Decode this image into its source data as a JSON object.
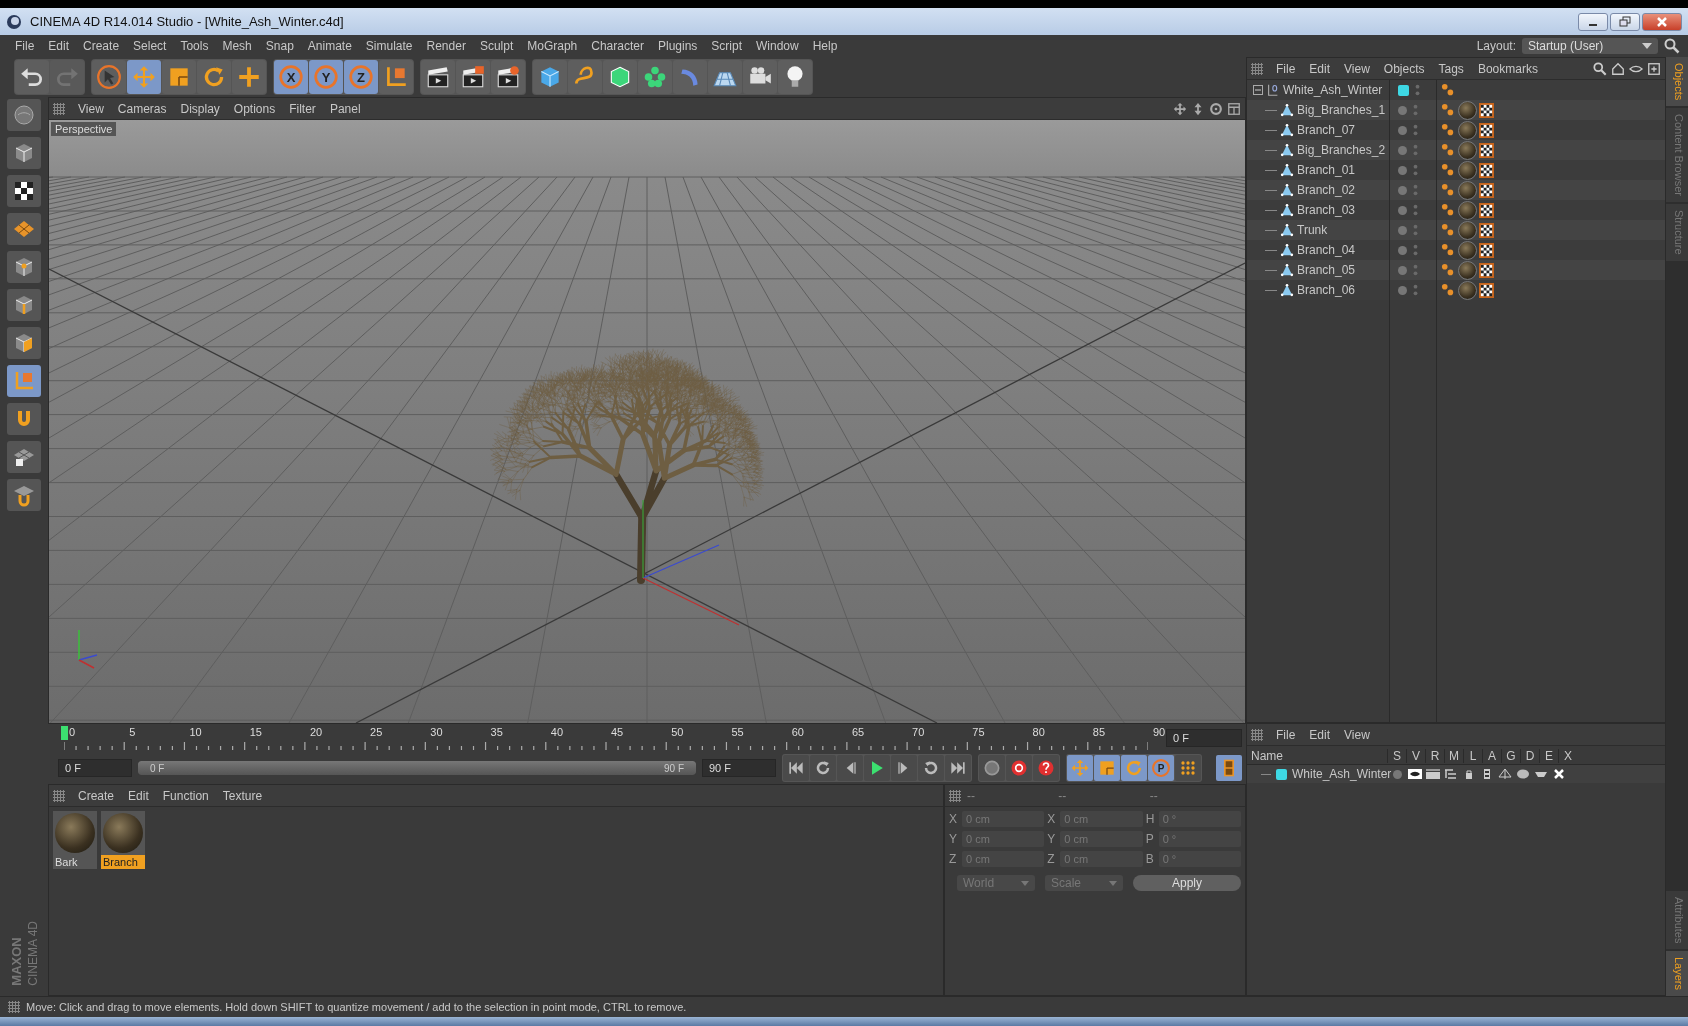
{
  "window": {
    "title": "CINEMA 4D R14.014 Studio - [White_Ash_Winter.c4d]"
  },
  "menu_bar": [
    "File",
    "Edit",
    "Create",
    "Select",
    "Tools",
    "Mesh",
    "Snap",
    "Animate",
    "Simulate",
    "Render",
    "Sculpt",
    "MoGraph",
    "Character",
    "Plugins",
    "Script",
    "Window",
    "Help"
  ],
  "layout": {
    "label": "Layout:",
    "value": "Startup (User)"
  },
  "toolbar": [
    {
      "items": [
        {
          "kind": "undo",
          "disabled": false,
          "selected": false
        },
        {
          "kind": "redo",
          "disabled": true,
          "selected": false
        }
      ]
    },
    {
      "items": [
        {
          "kind": "select",
          "selected": false
        },
        {
          "kind": "move",
          "selected": true
        },
        {
          "kind": "scale",
          "selected": false
        },
        {
          "kind": "rotate",
          "selected": false
        },
        {
          "kind": "add",
          "selected": false
        }
      ]
    },
    {
      "items": [
        {
          "kind": "axis-lock",
          "label": "X",
          "selected": true
        },
        {
          "kind": "axis-lock",
          "label": "Y",
          "selected": true
        },
        {
          "kind": "axis-lock",
          "label": "Z",
          "selected": true
        },
        {
          "kind": "coordinate-system",
          "selected": false
        }
      ]
    },
    {
      "items": [
        {
          "kind": "render-view",
          "selected": false
        },
        {
          "kind": "render-picture",
          "selected": false
        },
        {
          "kind": "render-settings",
          "selected": false
        }
      ]
    },
    {
      "items": [
        {
          "kind": "cube",
          "selected": false
        },
        {
          "kind": "spline",
          "selected": false
        },
        {
          "kind": "subdivision",
          "selected": false
        },
        {
          "kind": "cloner",
          "selected": false
        },
        {
          "kind": "deformer",
          "selected": false
        },
        {
          "kind": "floor",
          "selected": false
        },
        {
          "kind": "camera",
          "selected": false
        },
        {
          "kind": "light",
          "selected": false
        }
      ]
    }
  ],
  "left_toolbar": [
    {
      "kind": "sculpt",
      "selected": false
    },
    {
      "kind": "model",
      "selected": false
    },
    {
      "kind": "texture",
      "selected": false
    },
    {
      "kind": "workplane",
      "selected": false
    },
    {
      "kind": "points",
      "selected": false
    },
    {
      "kind": "edges",
      "selected": false
    },
    {
      "kind": "polygons",
      "selected": false
    },
    {
      "kind": "axis-mode",
      "selected": true
    },
    {
      "kind": "magnet",
      "selected": false
    },
    {
      "kind": "grid-lock",
      "selected": false
    },
    {
      "kind": "snap",
      "selected": false
    }
  ],
  "viewport": {
    "menu": [
      "View",
      "Cameras",
      "Display",
      "Options",
      "Filter",
      "Panel"
    ],
    "camera_label": "Perspective"
  },
  "timeline": {
    "ruler_labels": [
      "0",
      "5",
      "10",
      "15",
      "20",
      "25",
      "30",
      "35",
      "40",
      "45",
      "50",
      "55",
      "60",
      "65",
      "70",
      "75",
      "80",
      "85",
      "90"
    ],
    "current_frame": "0 F",
    "start": "0 F",
    "range": {
      "start": "0 F",
      "end": "90 F",
      "level": 1
    },
    "end": "90 F",
    "transport": [
      {
        "kind": "go-start"
      },
      {
        "kind": "prev-key"
      },
      {
        "kind": "prev-frame"
      },
      {
        "kind": "play"
      },
      {
        "kind": "next-frame"
      },
      {
        "kind": "next-key"
      },
      {
        "kind": "go-end"
      }
    ],
    "record": [
      {
        "kind": "keyframe-off"
      },
      {
        "kind": "record"
      },
      {
        "kind": "autokey"
      }
    ],
    "key_modes": [
      {
        "kind": "key-move",
        "selected": true
      },
      {
        "kind": "key-scale",
        "selected": true
      },
      {
        "kind": "key-rotate",
        "selected": true
      },
      {
        "kind": "key-param",
        "label": "P",
        "selected": true
      },
      {
        "kind": "key-points",
        "selected": false
      }
    ]
  },
  "materials": {
    "menu": [
      "Create",
      "Edit",
      "Function",
      "Texture"
    ],
    "items": [
      {
        "name": "Bark",
        "selected": false
      },
      {
        "name": "Branch",
        "selected": true
      }
    ]
  },
  "coordinates": {
    "headers": [
      "--",
      "--",
      "--"
    ],
    "rows": [
      {
        "pos_label": "X",
        "pos": "0 cm",
        "size_label": "X",
        "size": "0 cm",
        "rot_label": "H",
        "rot": "0 °"
      },
      {
        "pos_label": "Y",
        "pos": "0 cm",
        "size_label": "Y",
        "size": "0 cm",
        "rot_label": "P",
        "rot": "0 °"
      },
      {
        "pos_label": "Z",
        "pos": "0 cm",
        "size_label": "Z",
        "size": "0 cm",
        "rot_label": "B",
        "rot": "0 °"
      }
    ],
    "dropdowns": [
      "World",
      "Scale"
    ],
    "apply": "Apply"
  },
  "object_manager": {
    "menu": [
      "File",
      "Edit",
      "View",
      "Objects",
      "Tags",
      "Bookmarks"
    ],
    "objects": [
      {
        "name": "White_Ash_Winter",
        "kind": "null",
        "color": "#3ed8e4",
        "expanded": true,
        "tags": [
          {
            "kind": "phong"
          }
        ],
        "children": [
          {
            "name": "Big_Branches_1",
            "kind": "polygon",
            "tags": [
              {
                "kind": "phong"
              },
              {
                "kind": "material"
              },
              {
                "kind": "texture"
              }
            ]
          },
          {
            "name": "Branch_07",
            "kind": "polygon",
            "tags": [
              {
                "kind": "phong"
              },
              {
                "kind": "material"
              },
              {
                "kind": "texture"
              }
            ]
          },
          {
            "name": "Big_Branches_2",
            "kind": "polygon",
            "tags": [
              {
                "kind": "phong"
              },
              {
                "kind": "material"
              },
              {
                "kind": "texture"
              }
            ]
          },
          {
            "name": "Branch_01",
            "kind": "polygon",
            "tags": [
              {
                "kind": "phong"
              },
              {
                "kind": "material"
              },
              {
                "kind": "texture"
              }
            ]
          },
          {
            "name": "Branch_02",
            "kind": "polygon",
            "tags": [
              {
                "kind": "phong"
              },
              {
                "kind": "material"
              },
              {
                "kind": "texture"
              }
            ]
          },
          {
            "name": "Branch_03",
            "kind": "polygon",
            "tags": [
              {
                "kind": "phong"
              },
              {
                "kind": "material"
              },
              {
                "kind": "texture"
              }
            ]
          },
          {
            "name": "Trunk",
            "kind": "polygon",
            "tags": [
              {
                "kind": "phong"
              },
              {
                "kind": "material"
              },
              {
                "kind": "texture"
              }
            ]
          },
          {
            "name": "Branch_04",
            "kind": "polygon",
            "tags": [
              {
                "kind": "phong"
              },
              {
                "kind": "material"
              },
              {
                "kind": "texture"
              }
            ]
          },
          {
            "name": "Branch_05",
            "kind": "polygon",
            "tags": [
              {
                "kind": "phong"
              },
              {
                "kind": "material"
              },
              {
                "kind": "texture"
              }
            ]
          },
          {
            "name": "Branch_06",
            "kind": "polygon",
            "tags": [
              {
                "kind": "phong"
              },
              {
                "kind": "material"
              },
              {
                "kind": "texture"
              }
            ]
          }
        ]
      }
    ]
  },
  "side_tabs_top": [
    {
      "label": "Objects",
      "selected": true
    },
    {
      "label": "Content Browser",
      "selected": false
    },
    {
      "label": "Structure",
      "selected": false
    }
  ],
  "layer_manager": {
    "menu": [
      "File",
      "Edit",
      "View"
    ],
    "columns": [
      "Name",
      "S",
      "V",
      "R",
      "M",
      "L",
      "A",
      "G",
      "D",
      "E",
      "X"
    ],
    "layers": [
      {
        "name": "White_Ash_Winter",
        "color": "#3ed8e4"
      }
    ]
  },
  "side_tabs_bottom": [
    {
      "label": "Attributes",
      "selected": false
    },
    {
      "label": "Layers",
      "selected": true
    }
  ],
  "logo": {
    "brand": "MAXON",
    "product": "CINEMA 4D"
  },
  "status_bar": "Move: Click and drag to move elements. Hold down SHIFT to quantize movement / add to the selection in point mode, CTRL to remove."
}
